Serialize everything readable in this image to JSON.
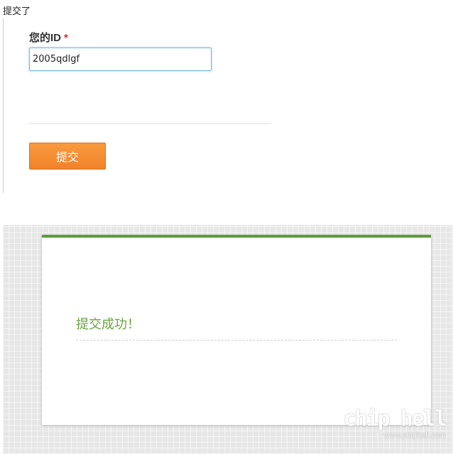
{
  "top_note": "提交了",
  "form": {
    "field_label": "您的ID",
    "required_mark": "*",
    "id_value": "2005qdlgf",
    "submit_label": "提交"
  },
  "result": {
    "message": "提交成功！",
    "accent_color": "#5a9c3c"
  },
  "watermark": {
    "logo_text": "chip hell",
    "url": "www.chiphell.com"
  },
  "colors": {
    "button": "#f28a31",
    "required": "#d32f2f",
    "success_text": "#6aa33f"
  }
}
